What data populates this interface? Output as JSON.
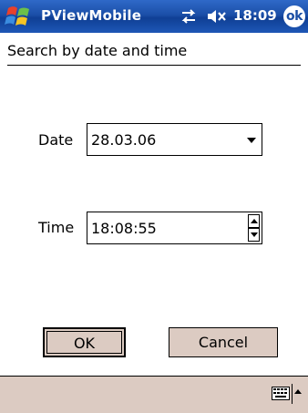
{
  "title_bar": {
    "app_title": "PViewMobile",
    "clock": "18:09",
    "ok_label": "ok",
    "icons": [
      "windows-start-icon",
      "connectivity-icon",
      "volume-muted-icon"
    ]
  },
  "page": {
    "title": "Search by date and time"
  },
  "form": {
    "date_label": "Date",
    "date_value": "28.03.06",
    "time_label": "Time",
    "time_value": "18:08:55"
  },
  "buttons": {
    "ok": "OK",
    "cancel": "Cancel"
  },
  "bottom_bar": {
    "icons": [
      "keyboard-icon",
      "input-menu-arrow-icon"
    ]
  },
  "colors": {
    "title_bar": "#1b4fa8",
    "button_face": "#dccbc2",
    "bottom_bar": "#dccbc2"
  }
}
